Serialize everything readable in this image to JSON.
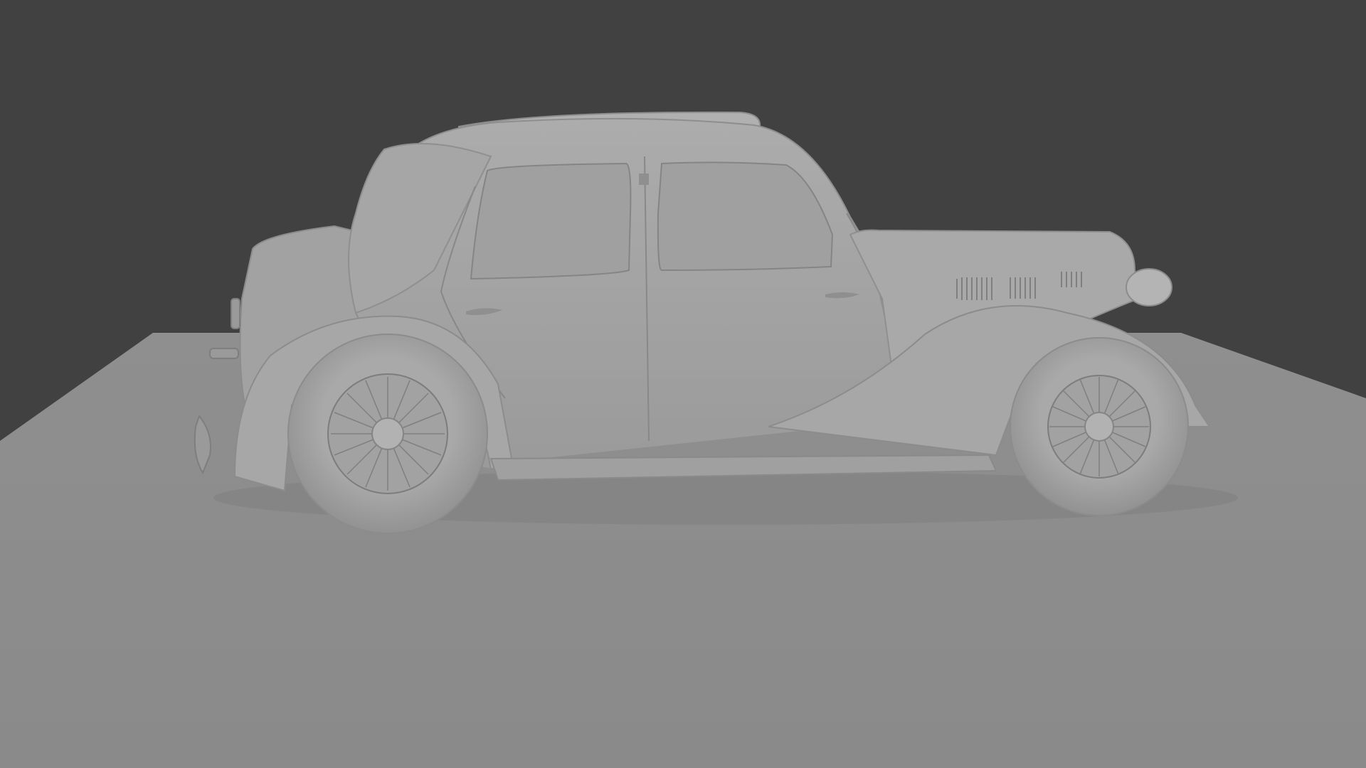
{
  "scene": {
    "subject": "car-model",
    "colors": {
      "background": "#414141",
      "floor_near": "#8a8a8a",
      "floor_far": "#8f8f8f",
      "body": "#a4a4a4",
      "body_light": "#b3b3b3",
      "body_shadow": "#8c8c8c",
      "tire": "#a8a8a8",
      "spokes": "#7d7d7d"
    }
  }
}
